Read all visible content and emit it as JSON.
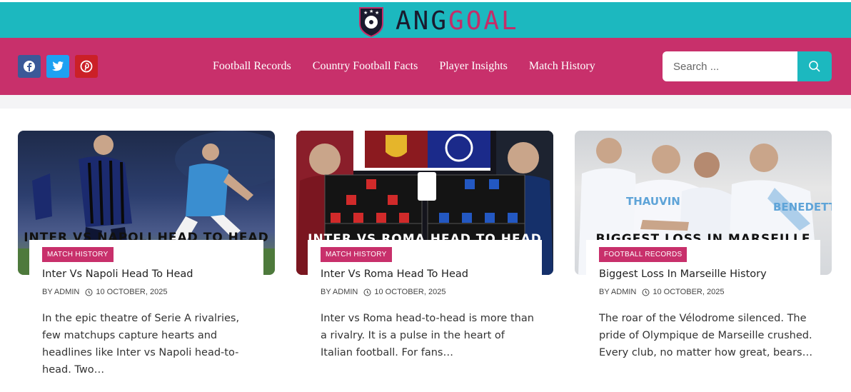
{
  "site": {
    "logo_part1": "ANG",
    "logo_part2": "GOAL",
    "colors": {
      "teal": "#1cb8bf",
      "pink": "#c8306b"
    }
  },
  "social": [
    {
      "name": "facebook-icon"
    },
    {
      "name": "twitter-icon"
    },
    {
      "name": "pinterest-icon"
    }
  ],
  "nav": {
    "items": [
      {
        "label": "Football Records"
      },
      {
        "label": "Country Football Facts"
      },
      {
        "label": "Player Insights"
      },
      {
        "label": "Match History"
      }
    ]
  },
  "search": {
    "placeholder": "Search ..."
  },
  "posts": [
    {
      "category": "MATCH HISTORY",
      "title": "Inter Vs Napoli Head To Head",
      "author": "BY ADMIN",
      "date": "10 OCTOBER, 2025",
      "excerpt": "In the epic theatre of Serie A rivalries, few matchups capture hearts and headlines like Inter vs Napoli head-to-head. Two…",
      "image_caption": "INTER VS NAPOLI HEAD TO HEAD"
    },
    {
      "category": "MATCH HISTORY",
      "title": "Inter Vs Roma Head To Head",
      "author": "BY ADMIN",
      "date": "10 OCTOBER, 2025",
      "excerpt": "Inter vs Roma head-to-head is more than a rivalry. It is a pulse in the heart of Italian football. For fans…",
      "image_caption": "INTER VS ROMA HEAD TO HEAD"
    },
    {
      "category": "FOOTBALL RECORDS",
      "title": "Biggest Loss In Marseille History",
      "author": "BY ADMIN",
      "date": "10 OCTOBER, 2025",
      "excerpt": "The roar of the Vélodrome silenced. The pride of Olympique de Marseille crushed. Every club, no matter how great, bears…",
      "image_caption": "BIGGEST LOSS IN MARSEILLE HISTORY"
    }
  ]
}
